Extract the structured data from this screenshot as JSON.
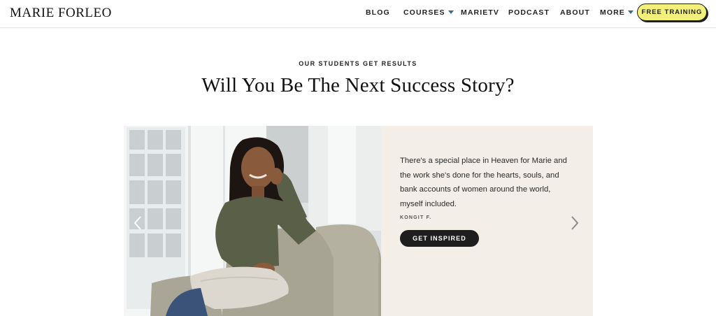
{
  "header": {
    "logo": "MARIE FORLEO",
    "nav": [
      {
        "label": "BLOG",
        "has_dropdown": false
      },
      {
        "label": "COURSES",
        "has_dropdown": true
      },
      {
        "label": "MARIETV",
        "has_dropdown": false
      },
      {
        "label": "PODCAST",
        "has_dropdown": false
      },
      {
        "label": "ABOUT",
        "has_dropdown": false
      },
      {
        "label": "MORE",
        "has_dropdown": true
      }
    ],
    "cta_label": "FREE TRAINING"
  },
  "hero": {
    "eyebrow": "OUR STUDENTS GET RESULTS",
    "headline": "Will You Be The Next Success Story?"
  },
  "testimonial": {
    "lines": [
      "There's a special place in Heaven for Marie and",
      "the work she's done for the hearts, souls, and",
      "bank accounts of women around the world,",
      "myself included."
    ],
    "author": "KONGIT F.",
    "button_label": "GET INSPIRED"
  },
  "colors": {
    "cta_background": "#f2f07a",
    "panel_background": "#f3efe8",
    "button_background": "#1e1e1e",
    "caret": "#3a6a8a"
  },
  "icons": {
    "prev": "chevron-left-icon",
    "next": "chevron-right-icon",
    "dropdown": "caret-down-icon"
  }
}
